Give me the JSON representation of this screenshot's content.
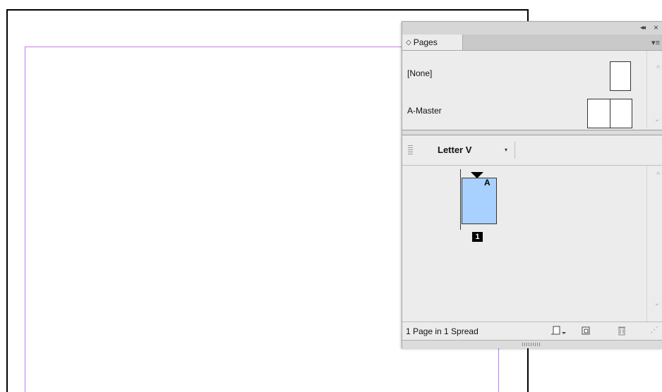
{
  "panel": {
    "tab_label": "Pages",
    "tab_arrows": "◇",
    "collapse": "◂◂",
    "close": "×",
    "menu": "▾≡"
  },
  "masters": {
    "none_label": "[None]",
    "a_master_label": "A-Master"
  },
  "size": {
    "label": "Letter V",
    "caret": "▾"
  },
  "pages": {
    "master_letter": "A",
    "page_number": "1"
  },
  "footer": {
    "status": "1 Page in 1 Spread"
  },
  "colors": {
    "margin_guide": "#c47bf0",
    "page_thumb": "#a9d1ff"
  }
}
